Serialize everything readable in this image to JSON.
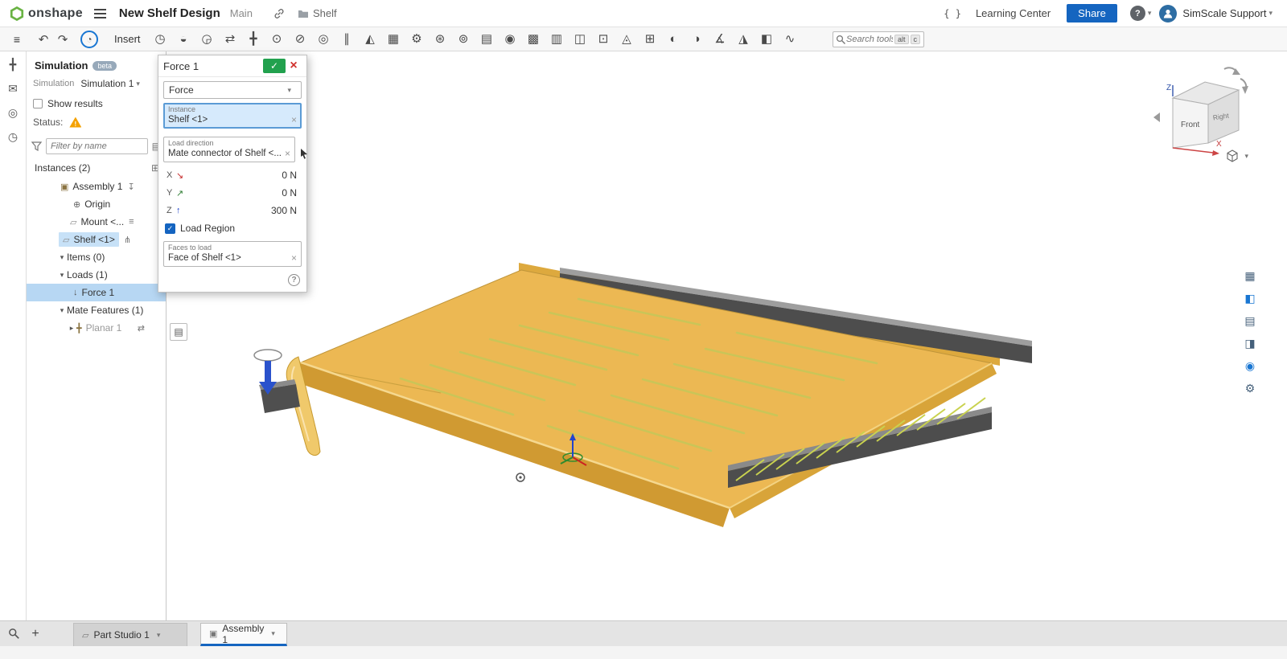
{
  "header": {
    "logo_text": "onshape",
    "title": "New Shelf Design",
    "workspace": "Main",
    "folder_name": "Shelf",
    "learning_center_label": "Learning Center",
    "share_label": "Share",
    "user_name": "SimScale Support"
  },
  "toolbar": {
    "insert_label": "Insert",
    "search_placeholder": "Search tools...",
    "shortcut_alt": "alt",
    "shortcut_key": "c",
    "icons": [
      {
        "name": "mate-connector-icon",
        "glyph": "◷"
      },
      {
        "name": "fastened-mate-icon",
        "glyph": "◒"
      },
      {
        "name": "revolute-mate-icon",
        "glyph": "◶"
      },
      {
        "name": "slider-mate-icon",
        "glyph": "⇄"
      },
      {
        "name": "planar-mate-icon",
        "glyph": "╋"
      },
      {
        "name": "cylindrical-mate-icon",
        "glyph": "⊙"
      },
      {
        "name": "pin-slot-mate-icon",
        "glyph": "⊘"
      },
      {
        "name": "ball-mate-icon",
        "glyph": "◎"
      },
      {
        "name": "parallel-mate-icon",
        "glyph": "∥"
      },
      {
        "name": "tangent-mate-icon",
        "glyph": "◭"
      },
      {
        "name": "group-icon",
        "glyph": "▦"
      },
      {
        "name": "mate-relations-icon",
        "glyph": "⚙"
      },
      {
        "name": "gear-relation-icon",
        "glyph": "⊛"
      },
      {
        "name": "screw-relation-icon",
        "glyph": "⊚"
      },
      {
        "name": "linear-pattern-icon",
        "glyph": "▤"
      },
      {
        "name": "circular-pattern-icon",
        "glyph": "◉"
      },
      {
        "name": "replicate-icon",
        "glyph": "▩"
      },
      {
        "name": "standard-content-icon",
        "glyph": "▥"
      },
      {
        "name": "insert-frame-icon",
        "glyph": "◫"
      },
      {
        "name": "snapshot-icon",
        "glyph": "⊡"
      },
      {
        "name": "exploded-view-icon",
        "glyph": "◬"
      },
      {
        "name": "named-positions-icon",
        "glyph": "⊞"
      },
      {
        "name": "display-states-icon",
        "glyph": "◐"
      },
      {
        "name": "appearance-icon",
        "glyph": "◑"
      },
      {
        "name": "measure-icon",
        "glyph": "∡"
      },
      {
        "name": "mass-properties-icon",
        "glyph": "◮"
      },
      {
        "name": "section-view-icon",
        "glyph": "◧"
      },
      {
        "name": "simulation-study-icon",
        "glyph": "∿"
      }
    ]
  },
  "left_strip": {
    "icons": [
      {
        "name": "simulation-setup-icon",
        "glyph": "╋"
      },
      {
        "name": "comments-icon",
        "glyph": "✉"
      },
      {
        "name": "inspect-icon",
        "glyph": "◎"
      },
      {
        "name": "history-icon",
        "glyph": "◷"
      }
    ]
  },
  "simulation_panel": {
    "title": "Simulation",
    "beta_badge": "beta",
    "simulation_label": "Simulation",
    "simulation_value": "Simulation 1",
    "show_results_label": "Show results",
    "status_label": "Status:",
    "filter_placeholder": "Filter by name",
    "instances_header": "Instances (2)",
    "tree": {
      "assembly": "Assembly 1",
      "origin": "Origin",
      "mount": "Mount <...",
      "shelf": "Shelf <1>"
    },
    "items_header": "Items (0)",
    "loads_header": "Loads (1)",
    "force_item": "Force 1",
    "mate_features_header": "Mate Features (1)",
    "planar_item": "Planar 1"
  },
  "force_dialog": {
    "title": "Force 1",
    "type_value": "Force",
    "instance_label": "Instance",
    "instance_value": "Shelf <1>",
    "direction_label": "Load direction",
    "direction_value": "Mate connector of Shelf <...",
    "axes": [
      {
        "axis": "X",
        "arrow": "↘",
        "value": "0 N"
      },
      {
        "axis": "Y",
        "arrow": "↗",
        "value": "0 N"
      },
      {
        "axis": "Z",
        "arrow": "↑",
        "value": "300 N"
      }
    ],
    "load_region_label": "Load Region",
    "faces_label": "Faces to load",
    "faces_value": "Face of Shelf <1>",
    "help_glyph": "?"
  },
  "viewport": {
    "view_cube": {
      "front_label": "Front",
      "right_label": "Right",
      "z_label": "Z",
      "x_label": "X"
    }
  },
  "right_strip": {
    "icons": [
      {
        "name": "bom-table-panel-icon",
        "glyph": "▦"
      },
      {
        "name": "configurations-panel-icon",
        "glyph": "◧"
      },
      {
        "name": "named-views-panel-icon",
        "glyph": "▤"
      },
      {
        "name": "display-states-panel-icon",
        "glyph": "◨"
      },
      {
        "name": "simulation-results-panel-icon",
        "glyph": "◉"
      },
      {
        "name": "panel-settings-icon",
        "glyph": "⚙"
      }
    ]
  },
  "bottom_bar": {
    "tabs": [
      {
        "label": "Part Studio 1"
      },
      {
        "label": "Assembly 1"
      }
    ]
  },
  "icons": {
    "undo": "↶",
    "redo": "↷",
    "help": "?",
    "tree_view": "≡",
    "active_tool": "◔",
    "insert_instance": "⊞",
    "filter_list": "▤",
    "assembly": "▣",
    "origin": "⊕",
    "part": "▱",
    "anchor": "↧",
    "rail": "≡",
    "mate": "⋔",
    "force": "↓",
    "planar": "╋",
    "slider": "⇄",
    "mate_list": "▤",
    "partstudio_tab": "▱",
    "assembly_tab": "▣"
  },
  "colors": {
    "accent_blue": "#1565c0",
    "selection_blue": "#b7d7f3",
    "field_highlight": "#d6eafc",
    "shelf_orange": "#ecb853",
    "rail_gray": "#4d4d4d",
    "confirm_green": "#22a14e",
    "cancel_red": "#d0312d",
    "warning_orange": "#f4a100"
  }
}
